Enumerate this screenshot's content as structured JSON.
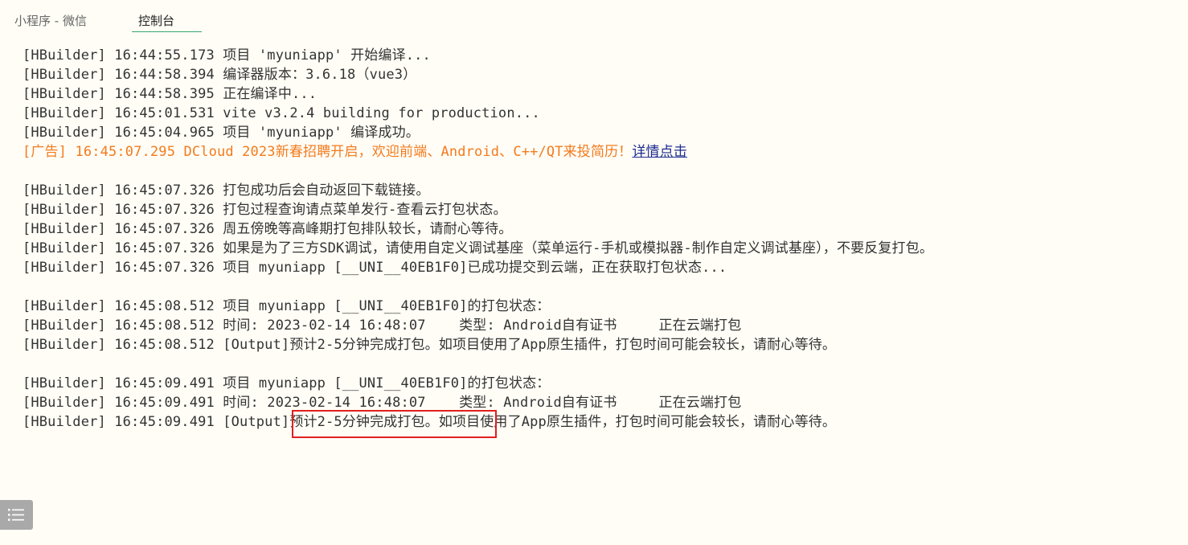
{
  "tabs": {
    "miniprogram_label": "小程序 - 微信",
    "console_label": "控制台"
  },
  "console": {
    "lines": [
      "[HBuilder] 16:44:55.173 项目 'myuniapp' 开始编译...",
      "[HBuilder] 16:44:58.394 编译器版本：3.6.18（vue3）",
      "[HBuilder] 16:44:58.395 正在编译中...",
      "[HBuilder] 16:45:01.531 vite v3.2.4 building for production...",
      "[HBuilder] 16:45:04.965 项目 'myuniapp' 编译成功。",
      "",
      "",
      "[HBuilder] 16:45:07.326 打包成功后会自动返回下载链接。",
      "[HBuilder] 16:45:07.326 打包过程查询请点菜单发行-查看云打包状态。",
      "[HBuilder] 16:45:07.326 周五傍晚等高峰期打包排队较长，请耐心等待。",
      "[HBuilder] 16:45:07.326 如果是为了三方SDK调试，请使用自定义调试基座（菜单运行-手机或模拟器-制作自定义调试基座），不要反复打包。",
      "[HBuilder] 16:45:07.326 项目 myuniapp [__UNI__40EB1F0]已成功提交到云端，正在获取打包状态...",
      "",
      "[HBuilder] 16:45:08.512 项目 myuniapp [__UNI__40EB1F0]的打包状态：",
      "[HBuilder] 16:45:08.512 时间: 2023-02-14 16:48:07    类型: Android自有证书     正在云端打包",
      "[HBuilder] 16:45:08.512 [Output]预计2-5分钟完成打包。如项目使用了App原生插件，打包时间可能会较长，请耐心等待。",
      "",
      "[HBuilder] 16:45:09.491 项目 myuniapp [__UNI__40EB1F0]的打包状态：",
      "[HBuilder] 16:45:09.491 时间: 2023-02-14 16:48:07    类型: Android自有证书     正在云端打包",
      "[HBuilder] 16:45:09.491 [Output]预计2-5分钟完成打包。如项目使用了App原生插件，打包时间可能会较长，请耐心等待。"
    ],
    "ad": {
      "text": "[广告] 16:45:07.295 DCloud 2023新春招聘开启，欢迎前端、Android、C++/QT来投简历！",
      "link": "详情点击"
    }
  },
  "colors": {
    "background": "#fffdf6",
    "text": "#333333",
    "ad": "#f37b1d",
    "link": "#1d2c8f",
    "active_tab_underline": "#39a86b",
    "highlight_border": "#e02020",
    "menu_button": "#a9a9a9"
  },
  "icons": {
    "menu": "list-menu-icon"
  }
}
